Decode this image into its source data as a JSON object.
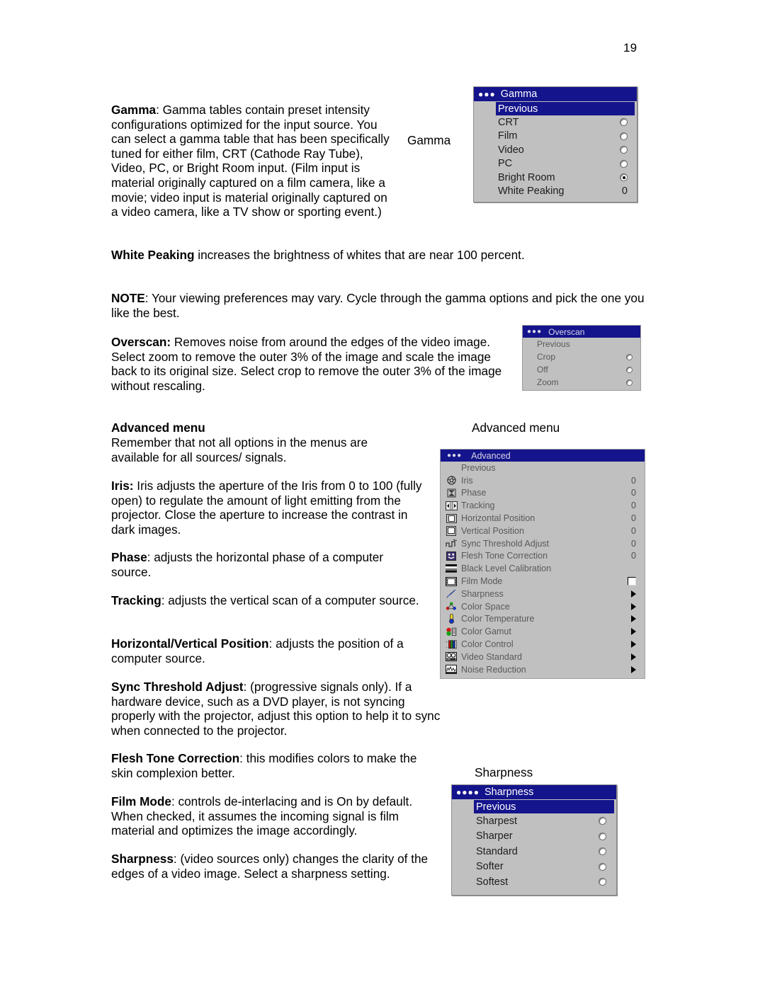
{
  "page": {
    "number": "19"
  },
  "body": {
    "gamma_para": "Gamma: Gamma tables contain preset intensity configurations optimized for the input source. You can select a gamma table that has been specifically tuned for either film, CRT (Cathode Ray Tube), Video, PC, or Bright Room input. (Film input is material originally captured on a film camera, like a movie; video input is material originally captured on a video camera, like a TV show or sporting event.)",
    "gamma_term": "Gamma",
    "white_peaking_term": "White Peaking",
    "white_peaking_rest": " increases the brightness of whites that are near 100 percent.",
    "note_term": "NOTE",
    "note_rest": ": Your viewing preferences may vary. Cycle through the gamma options and pick the one you like the best.",
    "overscan_term": "Overscan:",
    "overscan_rest": " Removes noise from around the edges of the video image. Select zoom to remove the outer 3% of the image and scale the image back to its original size. Select crop to remove the outer 3% of the image without rescaling.",
    "advanced_heading": "Advanced menu",
    "advanced_rest": "Remember that not all options in the menus are available for all sources/ signals.",
    "iris_term": "Iris:",
    "iris_rest": " Iris adjusts the aperture of the Iris from 0 to 100 (fully open) to regulate the amount of light emitting from the projector. Close the aperture to increase the contrast in dark images.",
    "phase_term": "Phase",
    "phase_rest": ": adjusts the horizontal phase of a computer source.",
    "tracking_term": "Tracking",
    "tracking_rest": ": adjusts the vertical scan of a computer source.",
    "hvpos_term": "Horizontal/Vertical Position",
    "hvpos_rest": ": adjusts the position of a computer source.",
    "sync_term": "Sync Threshold Adjust",
    "sync_rest": ": (progressive signals only). If a hardware device, such as a DVD player, is not syncing properly with the projector, adjust this option to help it to sync when connected to the projector.",
    "flesh_term": "Flesh Tone Correction",
    "flesh_rest": ": this modifies colors to make the skin complexion better.",
    "filmmode_term": "Film Mode",
    "filmmode_rest": ": controls de-interlacing and is On by default. When checked, it assumes the incoming signal is film material and optimizes the image accordingly.",
    "sharpness_term": "Sharpness",
    "sharpness_rest": ": (video sources only) changes the clarity of the edges of a video image. Select a sharpness setting."
  },
  "callouts": {
    "gamma": "Gamma",
    "advanced_menu": "Advanced menu",
    "sharpness": "Sharpness"
  },
  "colors": {
    "titlebar_blue": "#14148c",
    "panel_gray": "#c0c0c0",
    "highlight_blue": "#14148c"
  },
  "gamma_menu": {
    "dots": "●●●",
    "title": "Gamma",
    "previous": "Previous",
    "items": [
      {
        "label": "CRT",
        "control": "radio",
        "selected": false
      },
      {
        "label": "Film",
        "control": "radio",
        "selected": false
      },
      {
        "label": "Video",
        "control": "radio",
        "selected": false
      },
      {
        "label": "PC",
        "control": "radio",
        "selected": false
      },
      {
        "label": "Bright Room",
        "control": "radio",
        "selected": true
      },
      {
        "label": "White Peaking",
        "control": "value",
        "value": "0"
      }
    ]
  },
  "overscan_menu": {
    "dots": "●●●",
    "title": "Overscan",
    "previous": "Previous",
    "items": [
      {
        "label": "Crop",
        "control": "radio",
        "selected": false
      },
      {
        "label": "Off",
        "control": "radio",
        "selected": false
      },
      {
        "label": "Zoom",
        "control": "radio",
        "selected": false
      }
    ]
  },
  "advanced_menu": {
    "dots": "●●●",
    "title": "Advanced",
    "previous": "Previous",
    "items": [
      {
        "label": "Iris",
        "icon": "iris-icon",
        "control": "value",
        "value": "0"
      },
      {
        "label": "Phase",
        "icon": "phase-icon",
        "control": "value",
        "value": "0"
      },
      {
        "label": "Tracking",
        "icon": "tracking-icon",
        "control": "value",
        "value": "0"
      },
      {
        "label": "Horizontal Position",
        "icon": "horizontal-position-icon",
        "control": "value",
        "value": "0"
      },
      {
        "label": "Vertical Position",
        "icon": "vertical-position-icon",
        "control": "value",
        "value": "0"
      },
      {
        "label": "Sync Threshold Adjust",
        "icon": "sync-threshold-icon",
        "control": "value",
        "value": "0"
      },
      {
        "label": "Flesh Tone Correction",
        "icon": "flesh-tone-icon",
        "control": "value",
        "value": "0"
      },
      {
        "label": "Black Level Calibration",
        "icon": "black-level-icon",
        "control": "none",
        "value": ""
      },
      {
        "label": "Film Mode",
        "icon": "film-mode-icon",
        "control": "checkbox",
        "checked": false
      },
      {
        "label": "Sharpness",
        "icon": "sharpness-icon",
        "control": "arrow"
      },
      {
        "label": "Color Space",
        "icon": "color-space-icon",
        "control": "arrow"
      },
      {
        "label": "Color Temperature",
        "icon": "color-temperature-icon",
        "control": "arrow"
      },
      {
        "label": "Color Gamut",
        "icon": "color-gamut-icon",
        "control": "arrow"
      },
      {
        "label": "Color Control",
        "icon": "color-control-icon",
        "control": "arrow"
      },
      {
        "label": "Video Standard",
        "icon": "video-standard-icon",
        "control": "arrow"
      },
      {
        "label": "Noise Reduction",
        "icon": "noise-reduction-icon",
        "control": "arrow"
      }
    ]
  },
  "sharpness_menu": {
    "dots": "●●●●",
    "title": "Sharpness",
    "previous": "Previous",
    "items": [
      {
        "label": "Sharpest",
        "control": "radio",
        "selected": false
      },
      {
        "label": "Sharper",
        "control": "radio",
        "selected": false
      },
      {
        "label": "Standard",
        "control": "radio",
        "selected": false
      },
      {
        "label": "Softer",
        "control": "radio",
        "selected": false
      },
      {
        "label": "Softest",
        "control": "radio",
        "selected": false
      }
    ]
  }
}
